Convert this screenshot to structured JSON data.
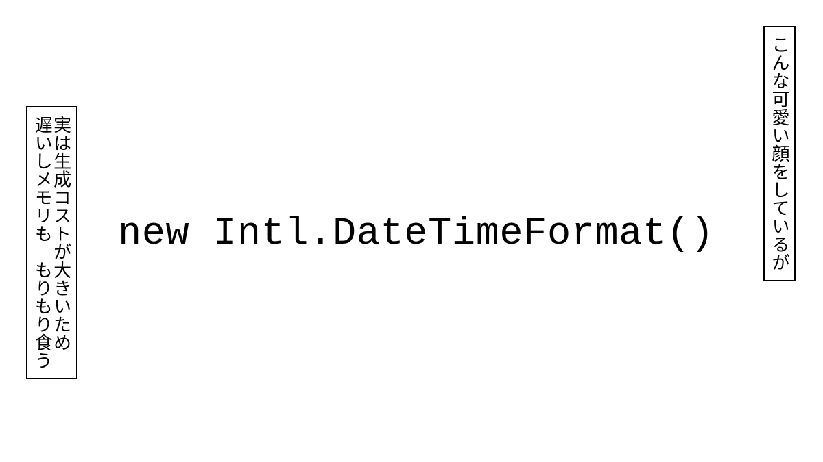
{
  "rightCaption": "こんな可愛い顔をしているが",
  "leftCaption": {
    "line1": "実は生成コストが大きいため",
    "line2": "遅いしメモリも　もりもり食う"
  },
  "centerCode": "new Intl.DateTimeFormat()"
}
